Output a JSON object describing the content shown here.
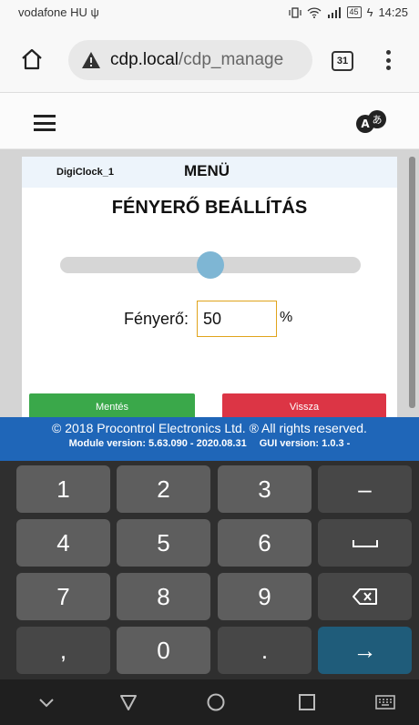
{
  "status": {
    "carrier": "vodafone HU",
    "battery": "45",
    "time": "14:25"
  },
  "browser": {
    "url_domain": "cdp.local",
    "url_path": "/cdp_manage",
    "tab_count": "31"
  },
  "panel": {
    "device_name": "DigiClock_1",
    "menu_title": "MENÜ",
    "page_title": "FÉNYERŐ BEÁLLÍTÁS",
    "brightness_label": "Fényerő:",
    "brightness_value": "50",
    "brightness_level": 0.5,
    "unit": "%",
    "save_label": "Mentés",
    "back_label": "Vissza"
  },
  "footer": {
    "copyright": "© 2018 Procontrol Electronics Ltd. ® All rights reserved.",
    "module_version": "Module version: 5.63.090 - 2020.08.31",
    "gui_version": "GUI version: 1.0.3 -"
  },
  "keyboard": {
    "keys": [
      "1",
      "2",
      "3",
      "4",
      "5",
      "6",
      "7",
      "8",
      "9",
      ",",
      "0",
      "."
    ],
    "minus": "–",
    "enter": "→"
  },
  "colors": {
    "footer_bg": "#1f66b8",
    "save_green": "#3aa84a",
    "back_red": "#dc3545",
    "slider_thumb": "#7eb6d4",
    "input_border": "#e0a41c"
  },
  "icons": {
    "home": "home-icon",
    "warning": "warning-icon",
    "tabs": "tabs-icon",
    "menu": "more-vert-icon",
    "hamburger": "hamburger-icon",
    "translate": "translate-icon",
    "backspace": "backspace-icon",
    "space": "space-icon"
  }
}
